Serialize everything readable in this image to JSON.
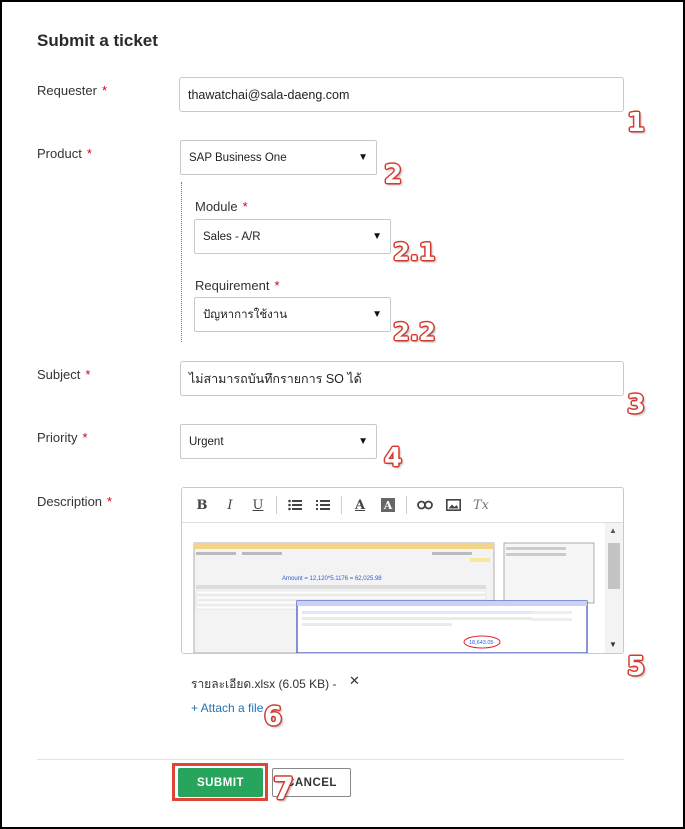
{
  "form": {
    "title": "Submit a ticket",
    "required_mark": "*",
    "requester": {
      "label": "Requester",
      "value": "thawatchai@sala-daeng.com"
    },
    "product": {
      "label": "Product",
      "value": "SAP Business One"
    },
    "module": {
      "label": "Module",
      "value": "Sales - A/R"
    },
    "requirement": {
      "label": "Requirement",
      "value": "ปัญหาการใช้งาน"
    },
    "subject": {
      "label": "Subject",
      "value": "ไม่สามารถบันทึกรายการ SO ได้"
    },
    "priority": {
      "label": "Priority",
      "value": "Urgent"
    },
    "description": {
      "label": "Description",
      "toolbar": [
        "bold-icon",
        "italic-icon",
        "underline-icon",
        "bulleted-list-icon",
        "numbered-list-icon",
        "text-color-icon",
        "highlight-icon",
        "link-icon",
        "image-icon",
        "clear-format-icon"
      ],
      "screenshot": {
        "amount_text": "Amount = 12,120*5.1176 = 62,025.98",
        "circled_value": "18,643.05"
      }
    },
    "attachment": {
      "name": "รายละเอียด.xlsx (6.05 KB) -",
      "remove": "✕",
      "link": "+ Attach a file"
    },
    "buttons": {
      "submit": "SUBMIT",
      "cancel": "CANCEL"
    }
  },
  "annotations": [
    "1",
    "2",
    "2.1",
    "2.2",
    "3",
    "4",
    "5",
    "6",
    "7"
  ],
  "colors": {
    "accent_green": "#27a55c",
    "required_red": "#d0021b",
    "annotation_red": "#e04437",
    "link_blue": "#1f73b7"
  }
}
